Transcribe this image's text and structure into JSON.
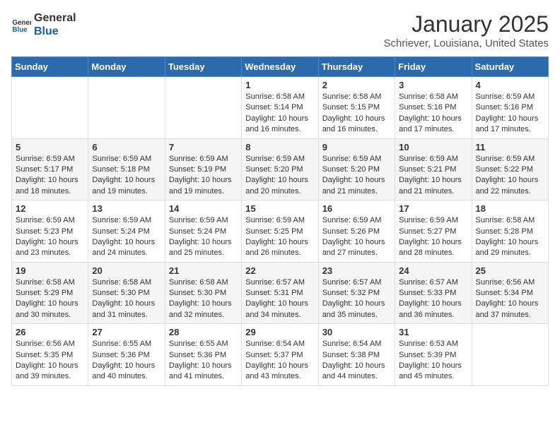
{
  "logo": {
    "text_general": "General",
    "text_blue": "Blue"
  },
  "header": {
    "month_year": "January 2025",
    "location": "Schriever, Louisiana, United States"
  },
  "weekdays": [
    "Sunday",
    "Monday",
    "Tuesday",
    "Wednesday",
    "Thursday",
    "Friday",
    "Saturday"
  ],
  "weeks": [
    [
      {
        "day": "",
        "sunrise": "",
        "sunset": "",
        "daylight": ""
      },
      {
        "day": "",
        "sunrise": "",
        "sunset": "",
        "daylight": ""
      },
      {
        "day": "",
        "sunrise": "",
        "sunset": "",
        "daylight": ""
      },
      {
        "day": "1",
        "sunrise": "Sunrise: 6:58 AM",
        "sunset": "Sunset: 5:14 PM",
        "daylight": "Daylight: 10 hours and 16 minutes."
      },
      {
        "day": "2",
        "sunrise": "Sunrise: 6:58 AM",
        "sunset": "Sunset: 5:15 PM",
        "daylight": "Daylight: 10 hours and 16 minutes."
      },
      {
        "day": "3",
        "sunrise": "Sunrise: 6:58 AM",
        "sunset": "Sunset: 5:16 PM",
        "daylight": "Daylight: 10 hours and 17 minutes."
      },
      {
        "day": "4",
        "sunrise": "Sunrise: 6:59 AM",
        "sunset": "Sunset: 5:16 PM",
        "daylight": "Daylight: 10 hours and 17 minutes."
      }
    ],
    [
      {
        "day": "5",
        "sunrise": "Sunrise: 6:59 AM",
        "sunset": "Sunset: 5:17 PM",
        "daylight": "Daylight: 10 hours and 18 minutes."
      },
      {
        "day": "6",
        "sunrise": "Sunrise: 6:59 AM",
        "sunset": "Sunset: 5:18 PM",
        "daylight": "Daylight: 10 hours and 19 minutes."
      },
      {
        "day": "7",
        "sunrise": "Sunrise: 6:59 AM",
        "sunset": "Sunset: 5:19 PM",
        "daylight": "Daylight: 10 hours and 19 minutes."
      },
      {
        "day": "8",
        "sunrise": "Sunrise: 6:59 AM",
        "sunset": "Sunset: 5:20 PM",
        "daylight": "Daylight: 10 hours and 20 minutes."
      },
      {
        "day": "9",
        "sunrise": "Sunrise: 6:59 AM",
        "sunset": "Sunset: 5:20 PM",
        "daylight": "Daylight: 10 hours and 21 minutes."
      },
      {
        "day": "10",
        "sunrise": "Sunrise: 6:59 AM",
        "sunset": "Sunset: 5:21 PM",
        "daylight": "Daylight: 10 hours and 21 minutes."
      },
      {
        "day": "11",
        "sunrise": "Sunrise: 6:59 AM",
        "sunset": "Sunset: 5:22 PM",
        "daylight": "Daylight: 10 hours and 22 minutes."
      }
    ],
    [
      {
        "day": "12",
        "sunrise": "Sunrise: 6:59 AM",
        "sunset": "Sunset: 5:23 PM",
        "daylight": "Daylight: 10 hours and 23 minutes."
      },
      {
        "day": "13",
        "sunrise": "Sunrise: 6:59 AM",
        "sunset": "Sunset: 5:24 PM",
        "daylight": "Daylight: 10 hours and 24 minutes."
      },
      {
        "day": "14",
        "sunrise": "Sunrise: 6:59 AM",
        "sunset": "Sunset: 5:24 PM",
        "daylight": "Daylight: 10 hours and 25 minutes."
      },
      {
        "day": "15",
        "sunrise": "Sunrise: 6:59 AM",
        "sunset": "Sunset: 5:25 PM",
        "daylight": "Daylight: 10 hours and 26 minutes."
      },
      {
        "day": "16",
        "sunrise": "Sunrise: 6:59 AM",
        "sunset": "Sunset: 5:26 PM",
        "daylight": "Daylight: 10 hours and 27 minutes."
      },
      {
        "day": "17",
        "sunrise": "Sunrise: 6:59 AM",
        "sunset": "Sunset: 5:27 PM",
        "daylight": "Daylight: 10 hours and 28 minutes."
      },
      {
        "day": "18",
        "sunrise": "Sunrise: 6:58 AM",
        "sunset": "Sunset: 5:28 PM",
        "daylight": "Daylight: 10 hours and 29 minutes."
      }
    ],
    [
      {
        "day": "19",
        "sunrise": "Sunrise: 6:58 AM",
        "sunset": "Sunset: 5:29 PM",
        "daylight": "Daylight: 10 hours and 30 minutes."
      },
      {
        "day": "20",
        "sunrise": "Sunrise: 6:58 AM",
        "sunset": "Sunset: 5:30 PM",
        "daylight": "Daylight: 10 hours and 31 minutes."
      },
      {
        "day": "21",
        "sunrise": "Sunrise: 6:58 AM",
        "sunset": "Sunset: 5:30 PM",
        "daylight": "Daylight: 10 hours and 32 minutes."
      },
      {
        "day": "22",
        "sunrise": "Sunrise: 6:57 AM",
        "sunset": "Sunset: 5:31 PM",
        "daylight": "Daylight: 10 hours and 34 minutes."
      },
      {
        "day": "23",
        "sunrise": "Sunrise: 6:57 AM",
        "sunset": "Sunset: 5:32 PM",
        "daylight": "Daylight: 10 hours and 35 minutes."
      },
      {
        "day": "24",
        "sunrise": "Sunrise: 6:57 AM",
        "sunset": "Sunset: 5:33 PM",
        "daylight": "Daylight: 10 hours and 36 minutes."
      },
      {
        "day": "25",
        "sunrise": "Sunrise: 6:56 AM",
        "sunset": "Sunset: 5:34 PM",
        "daylight": "Daylight: 10 hours and 37 minutes."
      }
    ],
    [
      {
        "day": "26",
        "sunrise": "Sunrise: 6:56 AM",
        "sunset": "Sunset: 5:35 PM",
        "daylight": "Daylight: 10 hours and 39 minutes."
      },
      {
        "day": "27",
        "sunrise": "Sunrise: 6:55 AM",
        "sunset": "Sunset: 5:36 PM",
        "daylight": "Daylight: 10 hours and 40 minutes."
      },
      {
        "day": "28",
        "sunrise": "Sunrise: 6:55 AM",
        "sunset": "Sunset: 5:36 PM",
        "daylight": "Daylight: 10 hours and 41 minutes."
      },
      {
        "day": "29",
        "sunrise": "Sunrise: 6:54 AM",
        "sunset": "Sunset: 5:37 PM",
        "daylight": "Daylight: 10 hours and 43 minutes."
      },
      {
        "day": "30",
        "sunrise": "Sunrise: 6:54 AM",
        "sunset": "Sunset: 5:38 PM",
        "daylight": "Daylight: 10 hours and 44 minutes."
      },
      {
        "day": "31",
        "sunrise": "Sunrise: 6:53 AM",
        "sunset": "Sunset: 5:39 PM",
        "daylight": "Daylight: 10 hours and 45 minutes."
      },
      {
        "day": "",
        "sunrise": "",
        "sunset": "",
        "daylight": ""
      }
    ]
  ]
}
